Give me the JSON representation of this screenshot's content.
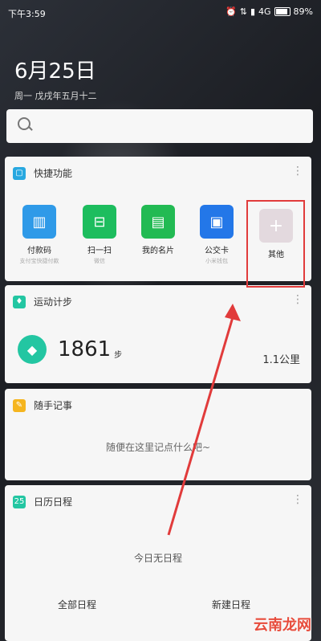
{
  "status_bar": {
    "time": "下午3:59",
    "network": "4G",
    "battery": "89%"
  },
  "date": {
    "main": "6月25日",
    "sub": "周一 戊戌年五月十二"
  },
  "quick_access": {
    "title": "快捷功能",
    "items": [
      {
        "label": "付款码",
        "sub": "支付宝快捷付款",
        "color": "#2f9ae8"
      },
      {
        "label": "扫一扫",
        "sub": "微信",
        "color": "#1dbd5e"
      },
      {
        "label": "我的名片",
        "sub": "",
        "color": "#22ba53"
      },
      {
        "label": "公交卡",
        "sub": "小米钱包",
        "color": "#2377e8"
      },
      {
        "label": "其他",
        "sub": "",
        "color": "#e3d9de"
      }
    ]
  },
  "steps": {
    "title": "运动计步",
    "count": "1861",
    "unit": "步",
    "distance": "1.1公里"
  },
  "notes": {
    "title": "随手记事",
    "placeholder": "随便在这里记点什么吧~"
  },
  "calendar": {
    "title": "日历日程",
    "icon_day": "25",
    "empty_text": "今日无日程",
    "all_button": "全部日程",
    "new_button": "新建日程"
  },
  "watermark": "云南龙网"
}
